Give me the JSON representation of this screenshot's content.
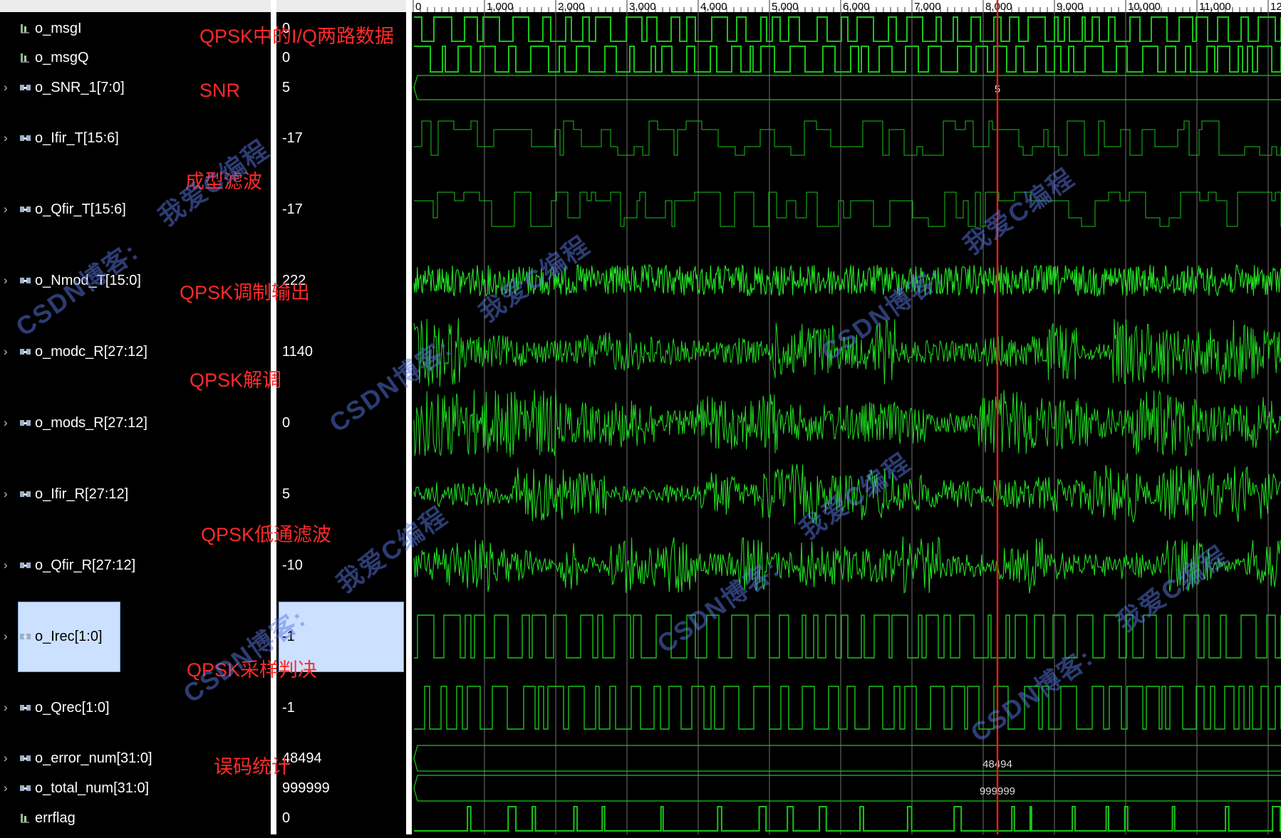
{
  "signals": [
    {
      "name": "o_msgI",
      "value": "0",
      "type": "bit",
      "expandable": false,
      "selected": false
    },
    {
      "name": "o_msgQ",
      "value": "0",
      "type": "bit",
      "expandable": false,
      "selected": false
    },
    {
      "name": "o_SNR_1[7:0]",
      "value": "5",
      "type": "bus",
      "expandable": true,
      "selected": false
    },
    {
      "name": "o_Ifir_T[15:6]",
      "value": "-17",
      "type": "bus",
      "expandable": true,
      "selected": false
    },
    {
      "name": "o_Qfir_T[15:6]",
      "value": "-17",
      "type": "bus",
      "expandable": true,
      "selected": false
    },
    {
      "name": "o_Nmod_T[15:0]",
      "value": "222",
      "type": "bus",
      "expandable": true,
      "selected": false
    },
    {
      "name": "o_modc_R[27:12]",
      "value": "1140",
      "type": "bus",
      "expandable": true,
      "selected": false
    },
    {
      "name": "o_mods_R[27:12]",
      "value": "0",
      "type": "bus",
      "expandable": true,
      "selected": false
    },
    {
      "name": "o_Ifir_R[27:12]",
      "value": "5",
      "type": "bus",
      "expandable": true,
      "selected": false
    },
    {
      "name": "o_Qfir_R[27:12]",
      "value": "-10",
      "type": "bus",
      "expandable": true,
      "selected": false
    },
    {
      "name": "o_Irec[1:0]",
      "value": "-1",
      "type": "bus",
      "expandable": true,
      "selected": true
    },
    {
      "name": "o_Qrec[1:0]",
      "value": "-1",
      "type": "bus",
      "expandable": true,
      "selected": false
    },
    {
      "name": "o_error_num[31:0]",
      "value": "48494",
      "type": "bus",
      "expandable": true,
      "selected": false
    },
    {
      "name": "o_total_num[31:0]",
      "value": "999999",
      "type": "bus",
      "expandable": true,
      "selected": false
    },
    {
      "name": "errflag",
      "value": "0",
      "type": "bit",
      "expandable": false,
      "selected": false
    }
  ],
  "timeline": {
    "labels": [
      "0",
      "1,000",
      "2,000",
      "3,000",
      "4,000",
      "5,000",
      "6,000",
      "7,000",
      "8,000",
      "9,000",
      "10,000",
      "11,000",
      "12"
    ],
    "cursor_time": 8200
  },
  "bus_labels": {
    "snr": "5",
    "error_num": "48494",
    "total_num": "999999"
  },
  "annotations": [
    "QPSK中的I/Q两路数据",
    "SNR",
    "成型滤波",
    "QPSK调制输出",
    "QPSK解调",
    "QPSK低通滤波",
    "QPSK采样判决",
    "误码统计"
  ],
  "watermark": {
    "blog_text": "CSDN博客:",
    "author_text": "我爱C编程"
  },
  "colors": {
    "wave": "#19c519",
    "analog": "#22dd22",
    "cursor": "#dd2020",
    "grid": "#cfcfcf",
    "annotation": "#ff2a2a",
    "selection": "#cce0ff"
  },
  "icons": {
    "bit": "bit-signal-icon",
    "bus": "bus-signal-icon",
    "expand": "chevron-right-icon"
  }
}
